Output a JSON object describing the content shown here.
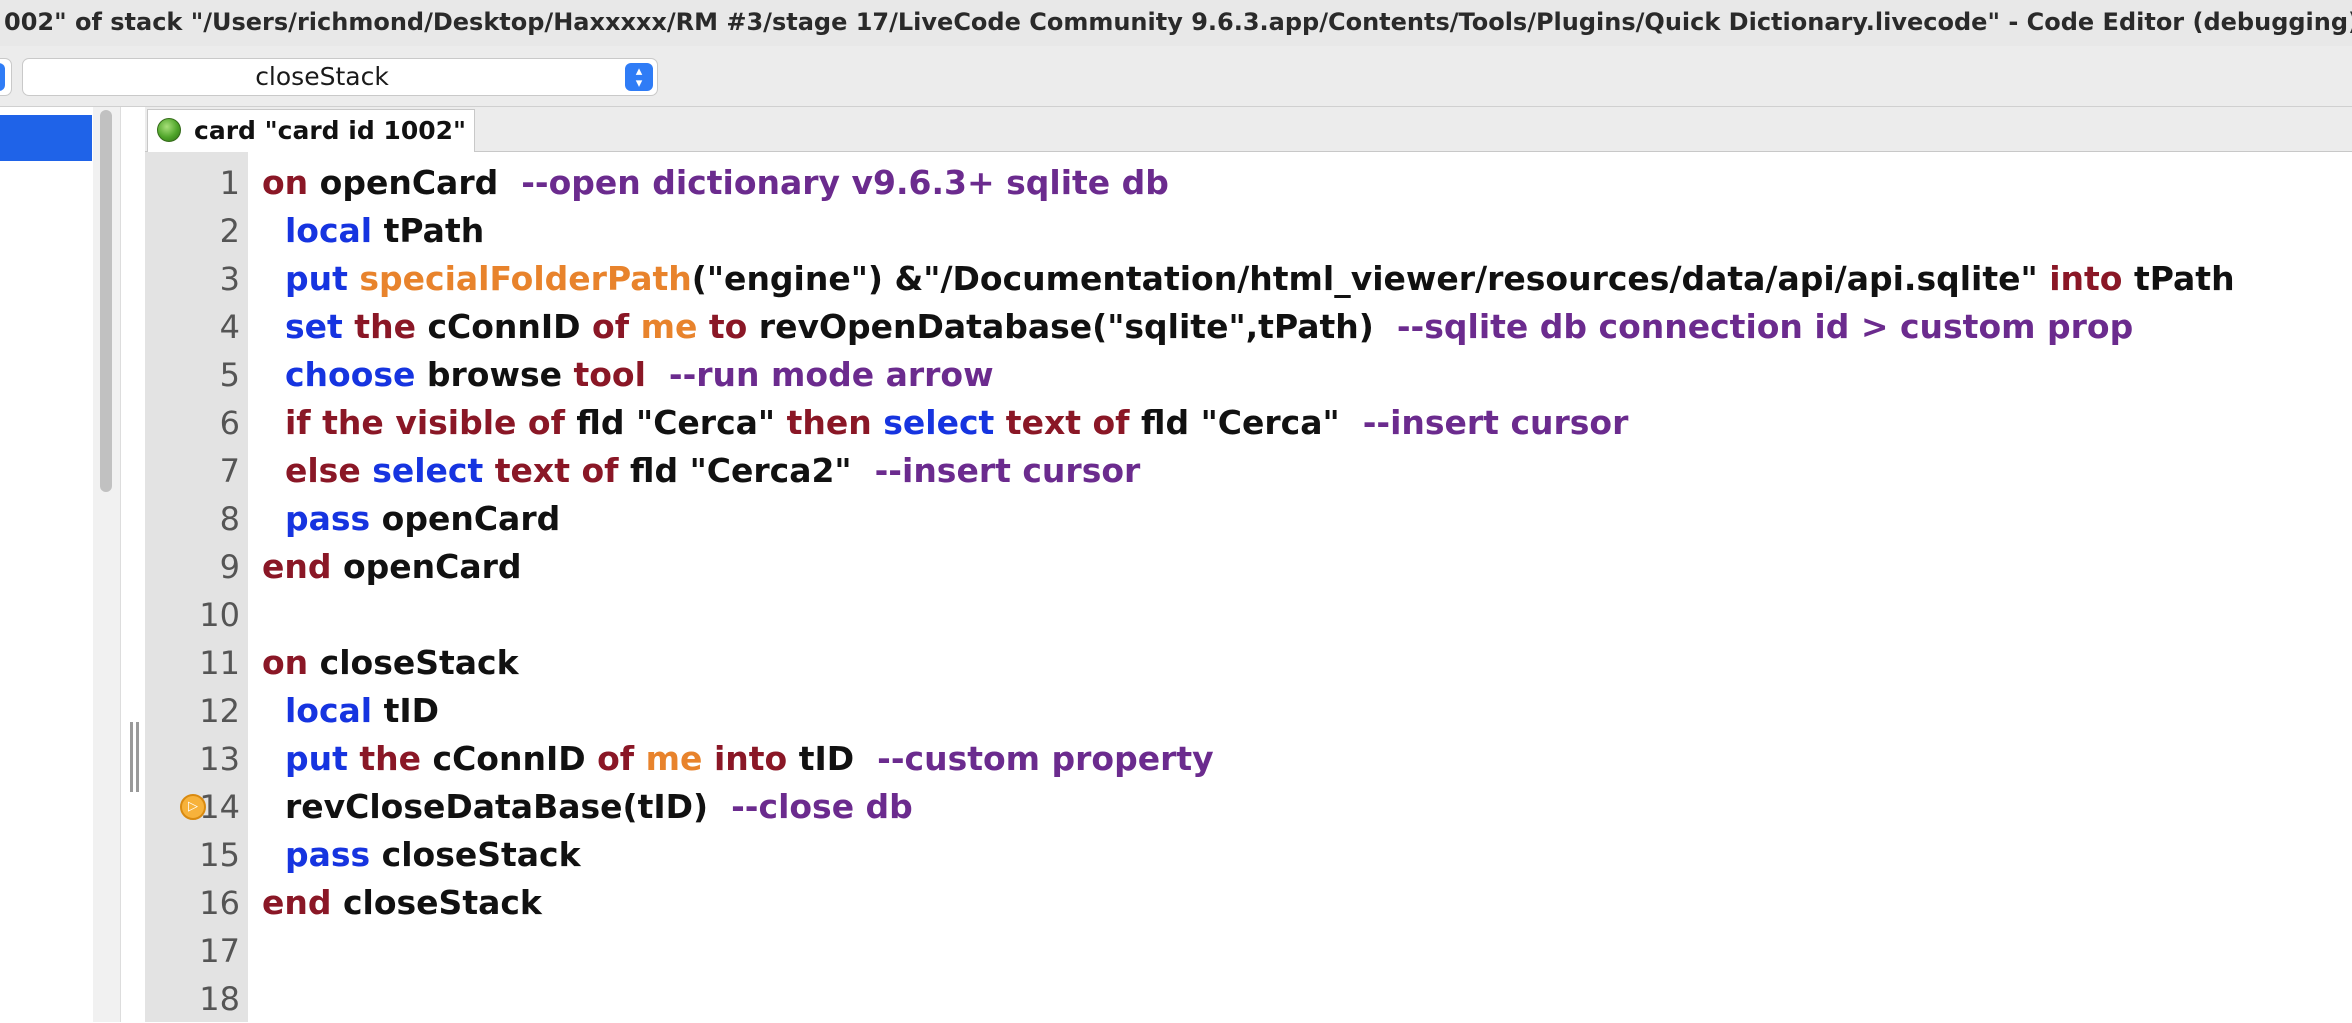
{
  "window": {
    "title": "002\" of stack \"/Users/richmond/Desktop/Haxxxxx/RM #3/stage 17/LiveCode Community 9.6.3.app/Contents/Tools/Plugins/Quick Dictionary.livecode\" - Code Editor (debugging)"
  },
  "toolbar": {
    "handler_popup": "closeStack"
  },
  "tabs": [
    {
      "label": "card \"card id 1002\""
    }
  ],
  "colors": {
    "control": "#8a1726",
    "command": "#1634e0",
    "property": "#e8832c",
    "comment": "#6b2b8e",
    "selection": "#1f63e8"
  },
  "icons": {
    "tab_status": "green-dot-icon",
    "breakpoint": "breakpoint-icon",
    "popup_stepper": "chevron-updown-icon"
  },
  "code": {
    "breakpoint_line": 14,
    "lines": [
      {
        "n": "1",
        "tokens": [
          {
            "t": "ctrl",
            "v": "on"
          },
          {
            "t": "plain",
            "v": " openCard  "
          },
          {
            "t": "cmt",
            "v": "--open dictionary v9.6.3+ sqlite db"
          }
        ]
      },
      {
        "n": "2",
        "tokens": [
          {
            "t": "plain",
            "v": "  "
          },
          {
            "t": "cmd",
            "v": "local"
          },
          {
            "t": "plain",
            "v": " tPath"
          }
        ]
      },
      {
        "n": "3",
        "tokens": [
          {
            "t": "plain",
            "v": "  "
          },
          {
            "t": "cmd",
            "v": "put"
          },
          {
            "t": "plain",
            "v": " "
          },
          {
            "t": "prop",
            "v": "specialFolderPath"
          },
          {
            "t": "plain",
            "v": "(\"engine\") &\"/Documentation/html_viewer/resources/data/api/api.sqlite\" "
          },
          {
            "t": "ctrl",
            "v": "into"
          },
          {
            "t": "plain",
            "v": " tPath"
          }
        ]
      },
      {
        "n": "4",
        "tokens": [
          {
            "t": "plain",
            "v": "  "
          },
          {
            "t": "cmd",
            "v": "set"
          },
          {
            "t": "plain",
            "v": " "
          },
          {
            "t": "ctrl",
            "v": "the"
          },
          {
            "t": "plain",
            "v": " cConnID "
          },
          {
            "t": "ctrl",
            "v": "of"
          },
          {
            "t": "plain",
            "v": " "
          },
          {
            "t": "prop",
            "v": "me"
          },
          {
            "t": "plain",
            "v": " "
          },
          {
            "t": "ctrl",
            "v": "to"
          },
          {
            "t": "plain",
            "v": " revOpenDatabase(\"sqlite\",tPath)  "
          },
          {
            "t": "cmt",
            "v": "--sqlite db connection id > custom prop"
          }
        ]
      },
      {
        "n": "5",
        "tokens": [
          {
            "t": "plain",
            "v": "  "
          },
          {
            "t": "cmd",
            "v": "choose"
          },
          {
            "t": "plain",
            "v": " browse "
          },
          {
            "t": "ctrl",
            "v": "tool"
          },
          {
            "t": "plain",
            "v": "  "
          },
          {
            "t": "cmt",
            "v": "--run mode arrow"
          }
        ]
      },
      {
        "n": "6",
        "tokens": [
          {
            "t": "plain",
            "v": "  "
          },
          {
            "t": "ctrl",
            "v": "if"
          },
          {
            "t": "plain",
            "v": " "
          },
          {
            "t": "ctrl",
            "v": "the"
          },
          {
            "t": "plain",
            "v": " "
          },
          {
            "t": "ctrl",
            "v": "visible"
          },
          {
            "t": "plain",
            "v": " "
          },
          {
            "t": "ctrl",
            "v": "of"
          },
          {
            "t": "plain",
            "v": " fld \"Cerca\" "
          },
          {
            "t": "ctrl",
            "v": "then"
          },
          {
            "t": "plain",
            "v": " "
          },
          {
            "t": "cmd",
            "v": "select"
          },
          {
            "t": "plain",
            "v": " "
          },
          {
            "t": "ctrl",
            "v": "text"
          },
          {
            "t": "plain",
            "v": " "
          },
          {
            "t": "ctrl",
            "v": "of"
          },
          {
            "t": "plain",
            "v": " fld \"Cerca\"  "
          },
          {
            "t": "cmt",
            "v": "--insert cursor"
          }
        ]
      },
      {
        "n": "7",
        "tokens": [
          {
            "t": "plain",
            "v": "  "
          },
          {
            "t": "ctrl",
            "v": "else"
          },
          {
            "t": "plain",
            "v": " "
          },
          {
            "t": "cmd",
            "v": "select"
          },
          {
            "t": "plain",
            "v": " "
          },
          {
            "t": "ctrl",
            "v": "text"
          },
          {
            "t": "plain",
            "v": " "
          },
          {
            "t": "ctrl",
            "v": "of"
          },
          {
            "t": "plain",
            "v": " fld \"Cerca2\"  "
          },
          {
            "t": "cmt",
            "v": "--insert cursor"
          }
        ]
      },
      {
        "n": "8",
        "tokens": [
          {
            "t": "plain",
            "v": "  "
          },
          {
            "t": "cmd",
            "v": "pass"
          },
          {
            "t": "plain",
            "v": " openCard"
          }
        ]
      },
      {
        "n": "9",
        "tokens": [
          {
            "t": "ctrl",
            "v": "end"
          },
          {
            "t": "plain",
            "v": " openCard"
          }
        ]
      },
      {
        "n": "10",
        "tokens": []
      },
      {
        "n": "11",
        "tokens": [
          {
            "t": "ctrl",
            "v": "on"
          },
          {
            "t": "plain",
            "v": " closeStack"
          }
        ]
      },
      {
        "n": "12",
        "tokens": [
          {
            "t": "plain",
            "v": "  "
          },
          {
            "t": "cmd",
            "v": "local"
          },
          {
            "t": "plain",
            "v": " tID"
          }
        ]
      },
      {
        "n": "13",
        "tokens": [
          {
            "t": "plain",
            "v": "  "
          },
          {
            "t": "cmd",
            "v": "put"
          },
          {
            "t": "plain",
            "v": " "
          },
          {
            "t": "ctrl",
            "v": "the"
          },
          {
            "t": "plain",
            "v": " cConnID "
          },
          {
            "t": "ctrl",
            "v": "of"
          },
          {
            "t": "plain",
            "v": " "
          },
          {
            "t": "prop",
            "v": "me"
          },
          {
            "t": "plain",
            "v": " "
          },
          {
            "t": "ctrl",
            "v": "into"
          },
          {
            "t": "plain",
            "v": " tID  "
          },
          {
            "t": "cmt",
            "v": "--custom property"
          }
        ]
      },
      {
        "n": "14",
        "tokens": [
          {
            "t": "plain",
            "v": "  revCloseDataBase(tID)  "
          },
          {
            "t": "cmt",
            "v": "--close db"
          }
        ]
      },
      {
        "n": "15",
        "tokens": [
          {
            "t": "plain",
            "v": "  "
          },
          {
            "t": "cmd",
            "v": "pass"
          },
          {
            "t": "plain",
            "v": " closeStack"
          }
        ]
      },
      {
        "n": "16",
        "tokens": [
          {
            "t": "ctrl",
            "v": "end"
          },
          {
            "t": "plain",
            "v": " closeStack"
          }
        ]
      },
      {
        "n": "17",
        "tokens": []
      },
      {
        "n": "18",
        "tokens": []
      }
    ]
  }
}
